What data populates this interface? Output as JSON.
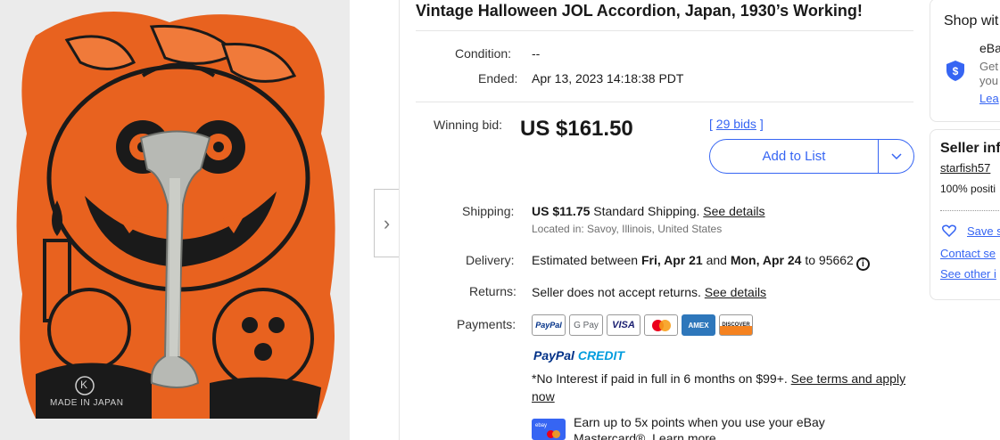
{
  "listing": {
    "title": "Vintage Halloween JOL Accordion, Japan, 1930’s Working!"
  },
  "photo": {
    "stamp_text": "MADE IN JAPAN",
    "logo_letter": "K"
  },
  "details": {
    "condition_label": "Condition:",
    "condition_value": "--",
    "ended_label": "Ended:",
    "ended_value": "Apr 13, 2023 14:18:38 PDT"
  },
  "bid": {
    "label": "Winning bid:",
    "price": "US $161.50",
    "bids_open": "[ ",
    "bids_count": "29 bids",
    "bids_close": " ]",
    "add_to_list": "Add to List"
  },
  "shipping": {
    "label": "Shipping:",
    "amount": "US $11.75",
    "method": " Standard Shipping. ",
    "details_link": "See details",
    "location": "Located in: Savoy, Illinois, United States"
  },
  "delivery": {
    "label": "Delivery:",
    "prefix": "Estimated between ",
    "start": "Fri, Apr 21",
    "and": " and ",
    "end": "Mon, Apr 24",
    "to": " to 95662"
  },
  "returns": {
    "label": "Returns:",
    "text": "Seller does not accept returns. ",
    "details_link": "See details"
  },
  "payments": {
    "label": "Payments:",
    "methods": [
      "PayPal",
      "G Pay",
      "VISA",
      "Mastercard",
      "AMEX",
      "DISCOVER"
    ],
    "paypal_credit_a": "PayPal",
    "paypal_credit_b": " CREDIT",
    "promo_text": "*No Interest if paid in full in 6 months on $99+. ",
    "promo_link": "See terms and apply now",
    "card_brand": "ebay",
    "earn_text": "Earn up to 5x points when you use your eBay Mastercard®. ",
    "earn_link": "Learn more"
  },
  "sidebar": {
    "shop_title": "Shop wit",
    "shop_line1": "eBa",
    "shop_line2": "Get",
    "shop_line3": "you",
    "shop_link": "Lea",
    "seller_title": "Seller inf",
    "seller_name": "starfish57",
    "seller_positive": "100% positi",
    "save_seller": "Save s",
    "contact_seller": "Contact se",
    "see_other": "See other i"
  },
  "colors": {
    "link_blue": "#3665f3",
    "pumpkin_orange": "#e8621f",
    "paypal_navy": "#003087"
  }
}
